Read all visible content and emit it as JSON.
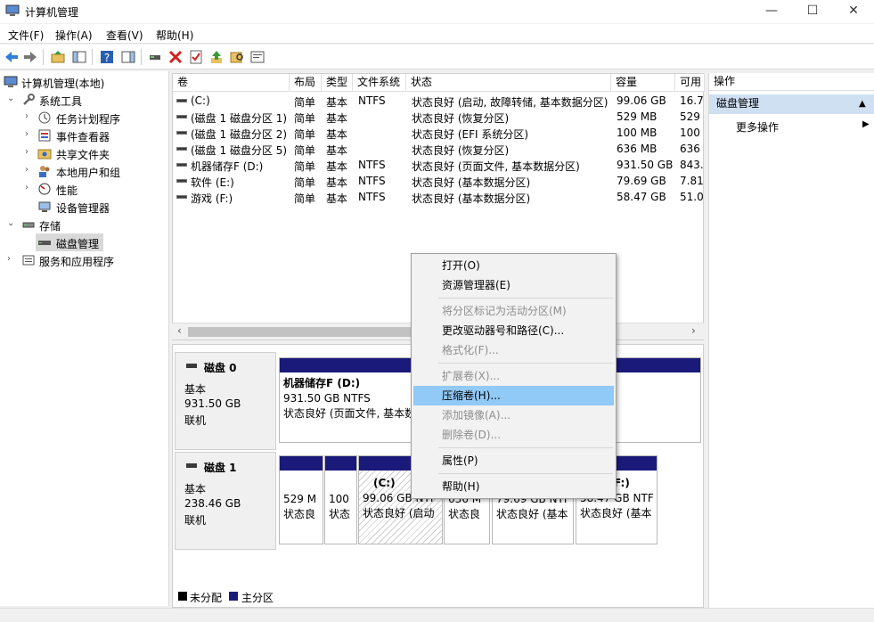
{
  "window": {
    "title": "计算机管理",
    "controls": [
      "—",
      "☐",
      "✕"
    ]
  },
  "menu": [
    "文件(F)",
    "操作(A)",
    "查看(V)",
    "帮助(H)"
  ],
  "tree": {
    "root": "计算机管理(本地)",
    "system_tools": "系统工具",
    "task_scheduler": "任务计划程序",
    "event_viewer": "事件查看器",
    "shared_folders": "共享文件夹",
    "local_users": "本地用户和组",
    "performance": "性能",
    "device_manager": "设备管理器",
    "storage": "存储",
    "disk_management": "磁盘管理",
    "services": "服务和应用程序"
  },
  "columns": [
    "卷",
    "布局",
    "类型",
    "文件系统",
    "状态",
    "容量",
    "可用"
  ],
  "volumes": [
    {
      "name": "(C:)",
      "layout": "简单",
      "type": "基本",
      "fs": "NTFS",
      "status": "状态良好 (启动, 故障转储, 基本数据分区)",
      "size": "99.06 GB",
      "free": "16.7"
    },
    {
      "name": "(磁盘 1 磁盘分区 1)",
      "layout": "简单",
      "type": "基本",
      "fs": "",
      "status": "状态良好 (恢复分区)",
      "size": "529 MB",
      "free": "529"
    },
    {
      "name": "(磁盘 1 磁盘分区 2)",
      "layout": "简单",
      "type": "基本",
      "fs": "",
      "status": "状态良好 (EFI 系统分区)",
      "size": "100 MB",
      "free": "100"
    },
    {
      "name": "(磁盘 1 磁盘分区 5)",
      "layout": "简单",
      "type": "基本",
      "fs": "",
      "status": "状态良好 (恢复分区)",
      "size": "636 MB",
      "free": "636"
    },
    {
      "name": "机器储存F (D:)",
      "layout": "简单",
      "type": "基本",
      "fs": "NTFS",
      "status": "状态良好 (页面文件, 基本数据分区)",
      "size": "931.50 GB",
      "free": "843."
    },
    {
      "name": "软件 (E:)",
      "layout": "简单",
      "type": "基本",
      "fs": "NTFS",
      "status": "状态良好 (基本数据分区)",
      "size": "79.69 GB",
      "free": "7.81"
    },
    {
      "name": "游戏 (F:)",
      "layout": "简单",
      "type": "基本",
      "fs": "NTFS",
      "status": "状态良好 (基本数据分区)",
      "size": "58.47 GB",
      "free": "51.0"
    }
  ],
  "disk0": {
    "name": "磁盘 0",
    "type": "基本",
    "size": "931.50 GB",
    "state": "联机",
    "part_name": "机器储存F  (D:)",
    "part_size": "931.50 GB NTFS",
    "part_status": "状态良好 (页面文件, 基本数"
  },
  "disk1": {
    "name": "磁盘 1",
    "type": "基本",
    "size": "238.46 GB",
    "state": "联机",
    "p1_size": "529 M",
    "p1_status": "状态良",
    "p2_size": "100",
    "p2_status": "状态",
    "c_name": "(C:)",
    "c_size": "99.06 GB NTF",
    "c_status": "状态良好 (启动",
    "p5_size": "636 M",
    "p5_status": "状态良",
    "e_size": "79.69 GB NTF",
    "e_status": "状态良好 (基本",
    "f_name": "F:)",
    "f_size": "58.47 GB NTF",
    "f_status": "状态良好 (基本"
  },
  "legend": {
    "unallocated": "未分配",
    "primary": "主分区"
  },
  "actions": {
    "header": "操作",
    "selected": "磁盘管理",
    "more": "更多操作"
  },
  "context_menu": {
    "open": "打开(O)",
    "explore": "资源管理器(E)",
    "mark_active": "将分区标记为活动分区(M)",
    "change_letter": "更改驱动器号和路径(C)...",
    "format": "格式化(F)...",
    "extend": "扩展卷(X)...",
    "shrink": "压缩卷(H)...",
    "add_mirror": "添加镜像(A)...",
    "delete": "删除卷(D)...",
    "properties": "属性(P)",
    "help": "帮助(H)"
  },
  "colors": {
    "primary_partition": "#1a1a7a",
    "unallocated": "#000000",
    "highlight": "#91c9f7"
  }
}
